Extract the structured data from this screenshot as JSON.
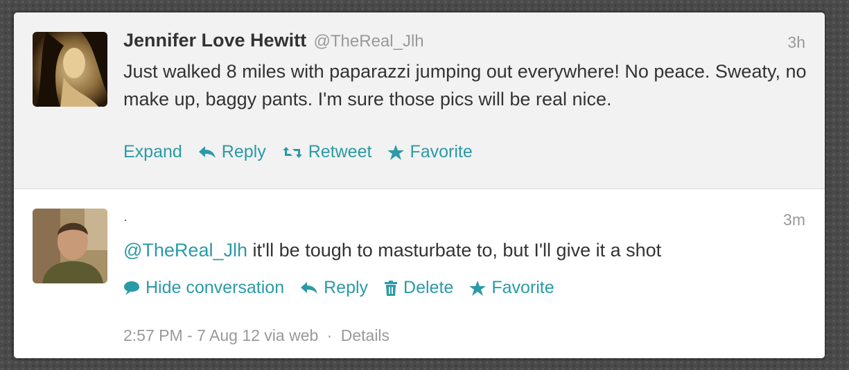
{
  "colors": {
    "accent": "#2a9aa6",
    "text": "#333333",
    "muted": "#999999",
    "highlight_bg": "#f2f2f2"
  },
  "tweets": [
    {
      "fullname": "Jennifer Love Hewitt",
      "username": "@TheReal_Jlh",
      "time": "3h",
      "text": "Just walked 8 miles with paparazzi jumping out everywhere! No peace. Sweaty, no make up, baggy pants. I'm sure those pics will be real nice.",
      "actions": {
        "expand": "Expand",
        "reply": "Reply",
        "retweet": "Retweet",
        "favorite": "Favorite"
      }
    },
    {
      "time": "3m",
      "mention": "@TheReal_Jlh",
      "text": " it'll be tough to masturbate to, but I'll give it a shot",
      "actions": {
        "hide_conversation": "Hide conversation",
        "reply": "Reply",
        "delete": "Delete",
        "favorite": "Favorite"
      },
      "meta": {
        "timestamp": "2:57 PM - 7 Aug 12 via web",
        "separator": "·",
        "details": "Details"
      }
    }
  ],
  "icons": {
    "reply": "reply-arrow-icon",
    "retweet": "retweet-icon",
    "favorite": "star-icon",
    "hide_conversation": "speech-bubble-icon",
    "delete": "trash-icon"
  }
}
